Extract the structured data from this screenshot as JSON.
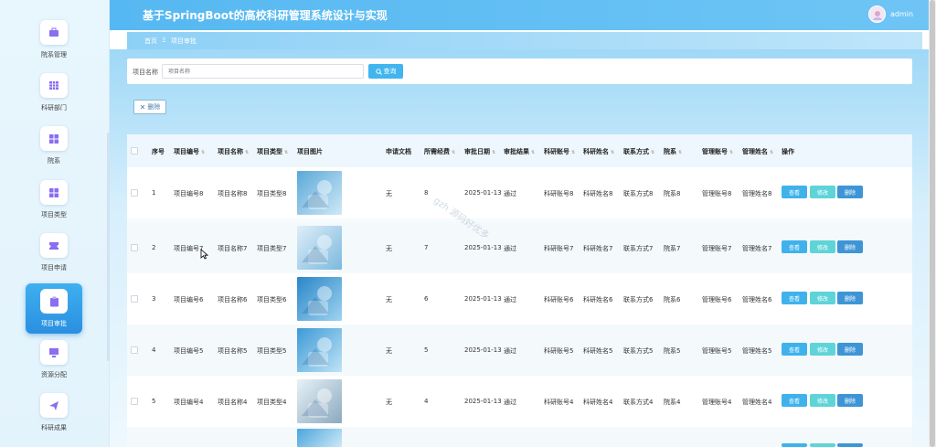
{
  "app": {
    "title": "基于SpringBoot的高校科研管理系统设计与实现",
    "user": "admin"
  },
  "breadcrumb": {
    "home": "首页",
    "sep": "Ξ",
    "current": "项目审批"
  },
  "sidebar": {
    "items": [
      {
        "label": "院系管理",
        "icon": "briefcase-icon"
      },
      {
        "label": "科研部门",
        "icon": "grid-icon"
      },
      {
        "label": "院系",
        "icon": "apps-icon"
      },
      {
        "label": "项目类型",
        "icon": "apps-icon"
      },
      {
        "label": "项目申请",
        "icon": "ticket-icon"
      },
      {
        "label": "项目审批",
        "icon": "clipboard-icon",
        "active": true
      },
      {
        "label": "资源分配",
        "icon": "monitor-icon"
      },
      {
        "label": "科研成果",
        "icon": "send-icon"
      }
    ]
  },
  "search": {
    "label": "项目名称",
    "placeholder": "项目名称",
    "button": "查询"
  },
  "toolbar": {
    "delete": "删除"
  },
  "table": {
    "headers": [
      "序号",
      "项目编号",
      "项目名称",
      "项目类型",
      "项目图片",
      "申请文档",
      "所需经费",
      "审批日期",
      "审批结果",
      "科研账号",
      "科研姓名",
      "联系方式",
      "院系",
      "管理账号",
      "管理姓名",
      "操作"
    ],
    "actions": {
      "view": "查看",
      "edit": "修改",
      "delete": "删除"
    },
    "rows": [
      {
        "idx": "1",
        "code": "项目编号8",
        "name": "项目名称8",
        "type": "项目类型8",
        "doc": "无",
        "fund": "8",
        "date": "2025-01-13",
        "result": "通过",
        "acct": "科研账号8",
        "rname": "科研姓名8",
        "contact": "联系方式8",
        "dept": "院系8",
        "macct": "管理账号8",
        "mname": "管理姓名8"
      },
      {
        "idx": "2",
        "code": "项目编号7",
        "name": "项目名称7",
        "type": "项目类型7",
        "doc": "无",
        "fund": "7",
        "date": "2025-01-13",
        "result": "通过",
        "acct": "科研账号7",
        "rname": "科研姓名7",
        "contact": "联系方式7",
        "dept": "院系7",
        "macct": "管理账号7",
        "mname": "管理姓名7"
      },
      {
        "idx": "3",
        "code": "项目编号6",
        "name": "项目名称6",
        "type": "项目类型6",
        "doc": "无",
        "fund": "6",
        "date": "2025-01-13",
        "result": "通过",
        "acct": "科研账号6",
        "rname": "科研姓名6",
        "contact": "联系方式6",
        "dept": "院系6",
        "macct": "管理账号6",
        "mname": "管理姓名6"
      },
      {
        "idx": "4",
        "code": "项目编号5",
        "name": "项目名称5",
        "type": "项目类型5",
        "doc": "无",
        "fund": "5",
        "date": "2025-01-13",
        "result": "通过",
        "acct": "科研账号5",
        "rname": "科研姓名5",
        "contact": "联系方式5",
        "dept": "院系5",
        "macct": "管理账号5",
        "mname": "管理姓名5"
      },
      {
        "idx": "5",
        "code": "项目编号4",
        "name": "项目名称4",
        "type": "项目类型4",
        "doc": "无",
        "fund": "4",
        "date": "2025-01-13",
        "result": "通过",
        "acct": "科研账号4",
        "rname": "科研姓名4",
        "contact": "联系方式4",
        "dept": "院系4",
        "macct": "管理账号4",
        "mname": "管理姓名4"
      }
    ]
  },
  "watermark": "gzh 源码好优多",
  "colors": {
    "header": "#56b8f2",
    "view": "#3fb2ec",
    "edit": "#5fd4d8",
    "delete": "#3d95d6"
  }
}
